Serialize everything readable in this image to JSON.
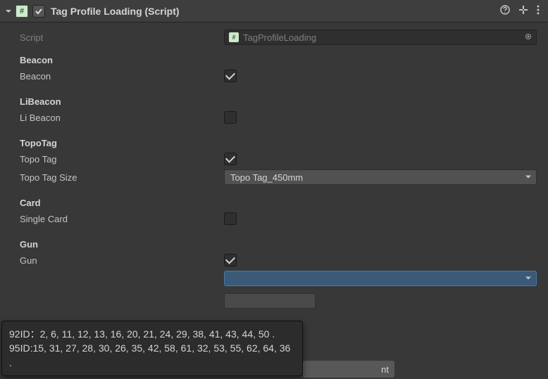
{
  "header": {
    "title": "Tag Profile Loading (Script)",
    "enabled": true
  },
  "script": {
    "label": "Script",
    "value": "TagProfileLoading"
  },
  "sections": {
    "beacon": {
      "title": "Beacon",
      "field_label": "Beacon",
      "checked": true
    },
    "libeacon": {
      "title": "LiBeacon",
      "field_label": "Li Beacon",
      "checked": false
    },
    "topotag": {
      "title": "TopoTag",
      "field_label": "Topo Tag",
      "checked": true,
      "size_label": "Topo Tag Size",
      "size_value": "Topo Tag_450mm"
    },
    "card": {
      "title": "Card",
      "field_label": "Single Card",
      "checked": false
    },
    "gun": {
      "title": "Gun",
      "field_label": "Gun",
      "checked": true
    }
  },
  "tooltip_text": "92ID：2, 6, 11, 12, 13, 16, 20, 21, 24, 29, 38, 41, 43, 44, 50 . 95ID:15, 31, 27, 28, 30, 26, 35, 42, 58, 61, 32, 53, 55, 62, 64, 36 .",
  "peek_button_suffix": "nt"
}
